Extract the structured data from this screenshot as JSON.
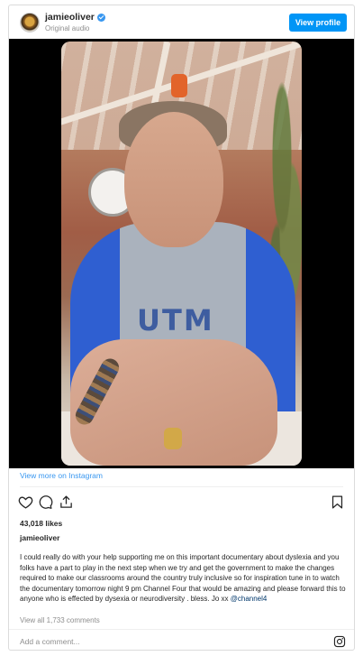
{
  "header": {
    "username": "jamieoliver",
    "subtitle": "Original audio",
    "view_profile_label": "View profile"
  },
  "media": {
    "shirt_text": "UTM"
  },
  "view_more_label": "View more on Instagram",
  "likes_label": "43,018 likes",
  "caption": {
    "username": "jamieoliver",
    "text": "I could really do with your help supporting me on this important documentary about dyslexia and you folks have a part to play in the next step when we try and get the government to make the changes required to make our classrooms around the country truly inclusive so for inspiration tune in to watch the documentary tomorrow night 9 pm Channel Four that would be amazing and please forward this to anyone who is effected by dysexia or neurodiversity . bless. Jo xx ",
    "mention": "@channel4"
  },
  "comments_label": "View all 1,733 comments",
  "comment_placeholder": "Add a comment...",
  "icons": {
    "verified": "verified-badge-icon",
    "like": "heart-icon",
    "comment": "comment-bubble-icon",
    "share": "share-icon",
    "save": "bookmark-icon",
    "brand": "instagram-icon"
  },
  "colors": {
    "accent": "#0095f6",
    "link": "#3897f0",
    "muted": "#8e8e8e"
  }
}
